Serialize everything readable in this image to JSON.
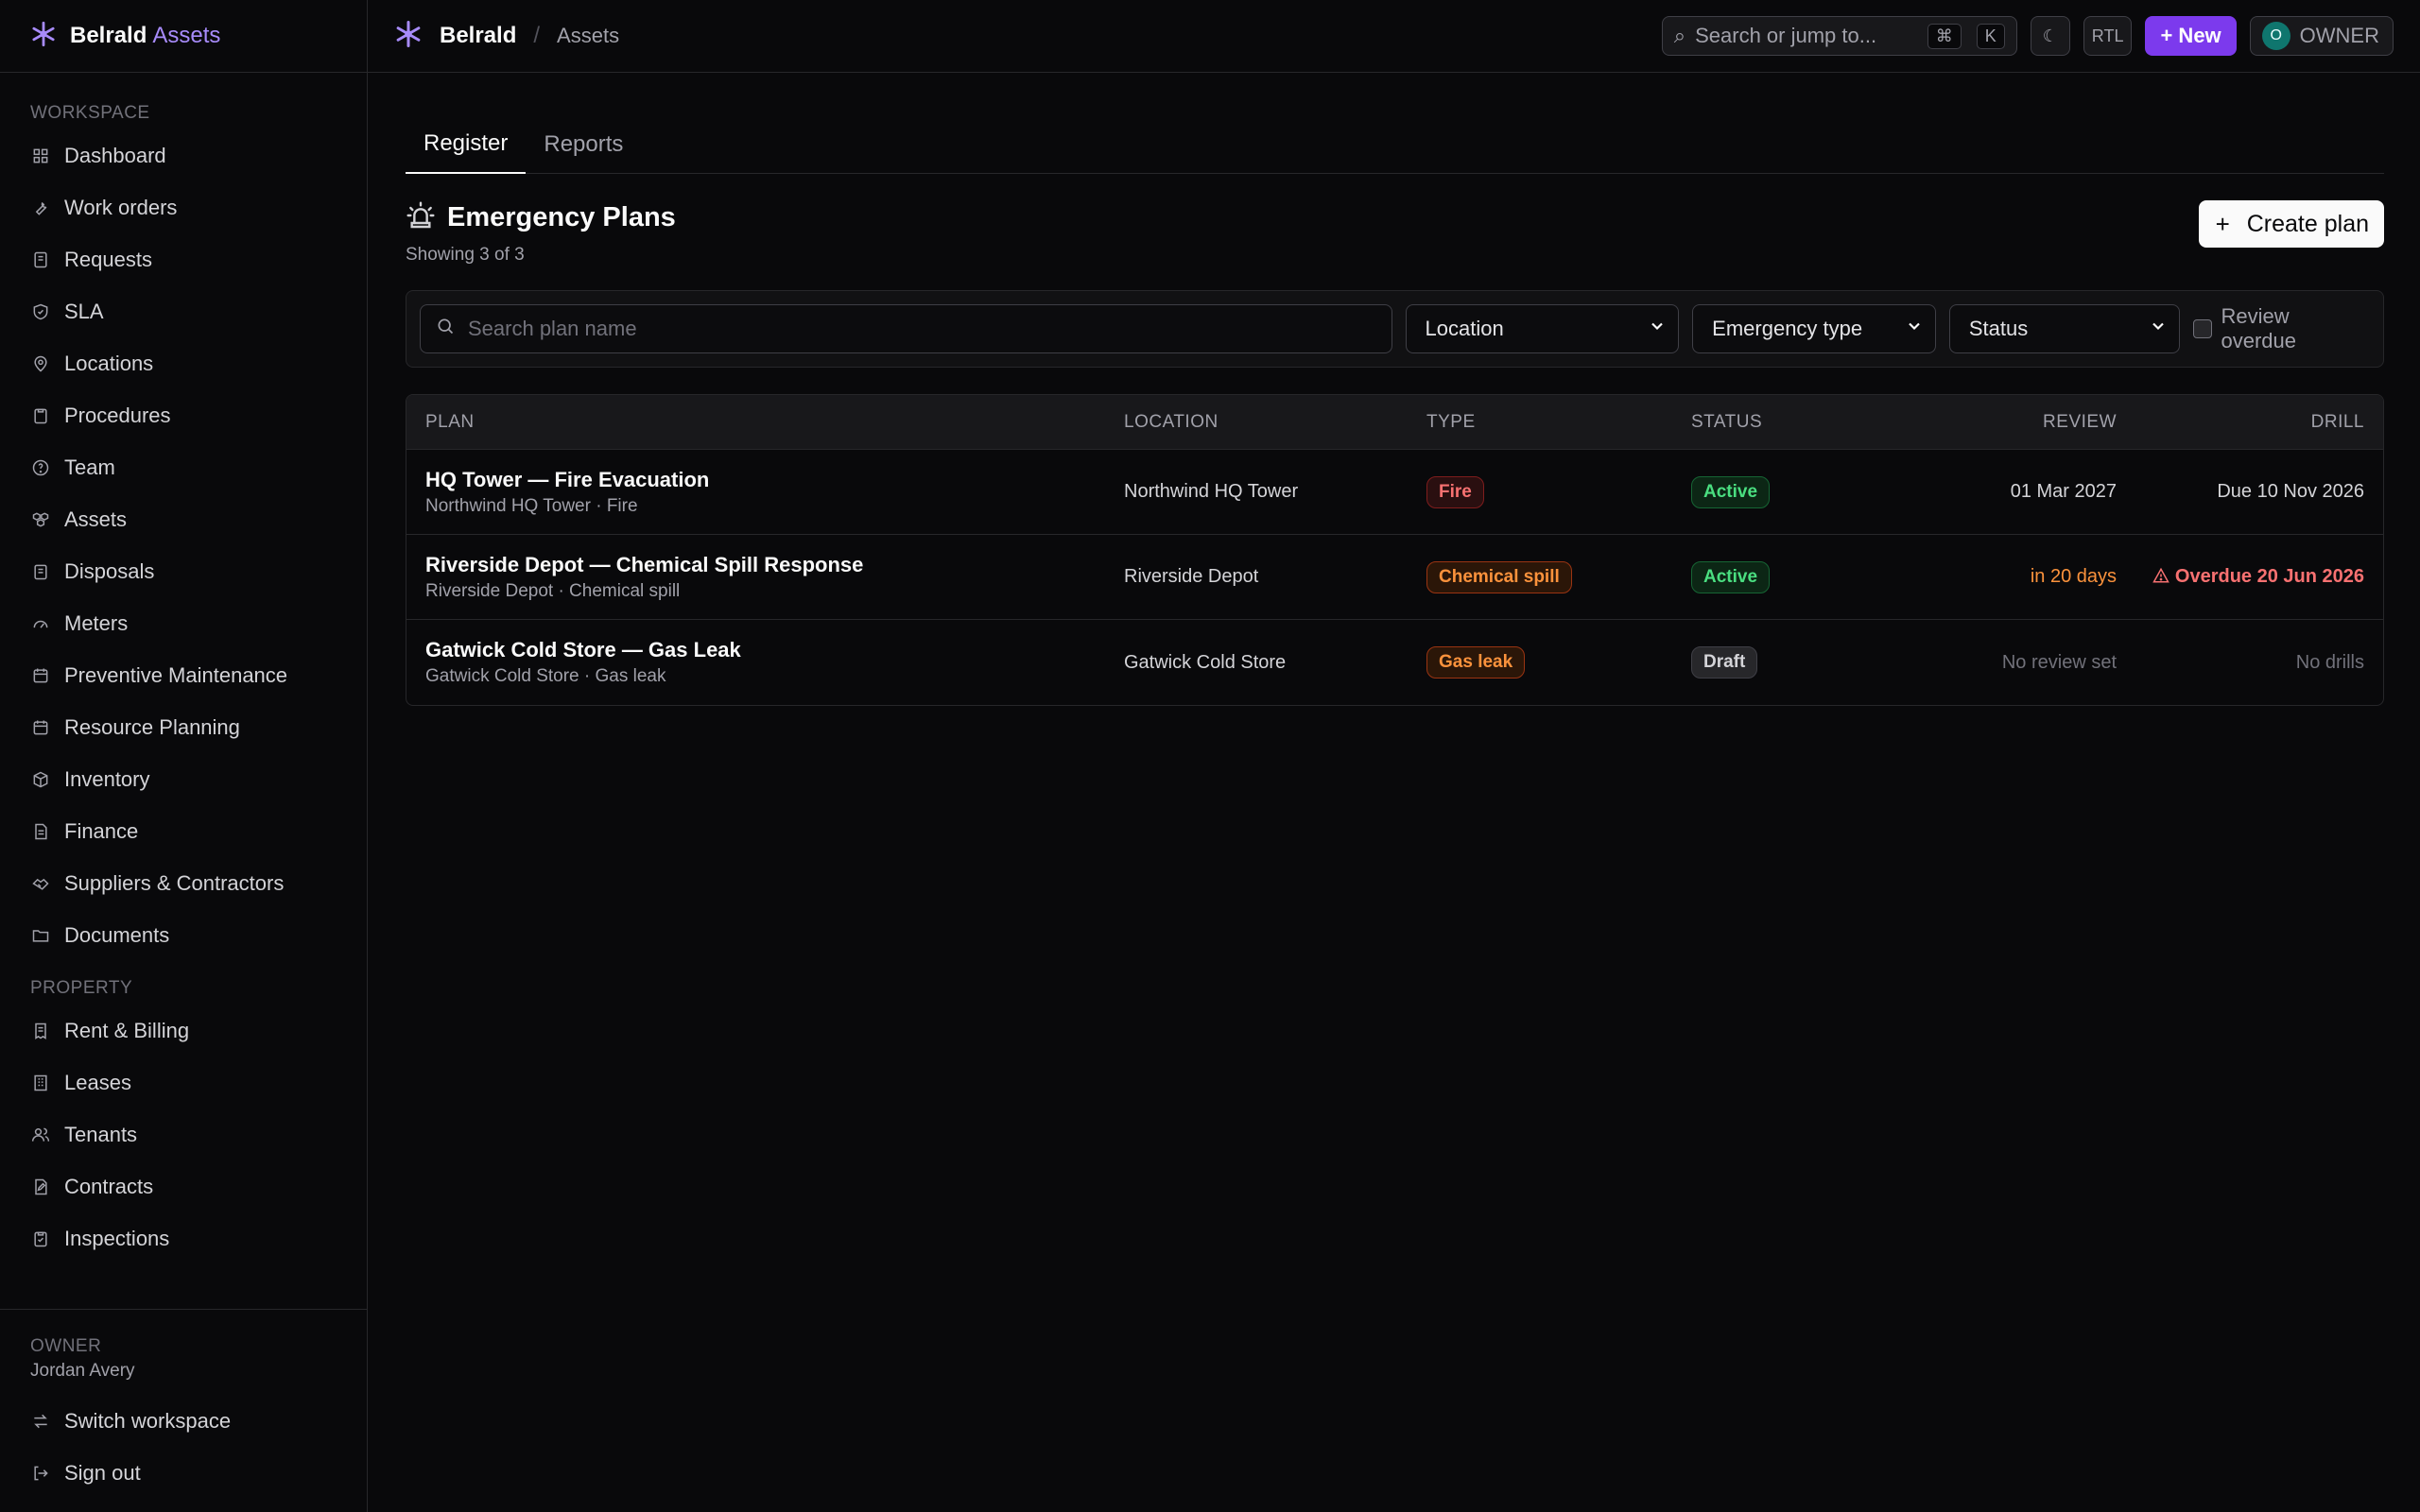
{
  "brand": {
    "name": "Belrald",
    "accent": "Assets"
  },
  "sidebar": {
    "workspace_label": "WORKSPACE",
    "workspace_items": [
      {
        "label": "Dashboard",
        "icon": "grid-icon"
      },
      {
        "label": "Work orders",
        "icon": "wrench-icon"
      },
      {
        "label": "Requests",
        "icon": "inbox-icon"
      },
      {
        "label": "SLA",
        "icon": "shield-icon"
      },
      {
        "label": "Locations",
        "icon": "pin-icon"
      },
      {
        "label": "Procedures",
        "icon": "clipboard-icon"
      },
      {
        "label": "Team",
        "icon": "help-circle-icon"
      },
      {
        "label": "Assets",
        "icon": "boxes-icon"
      },
      {
        "label": "Disposals",
        "icon": "trash-icon"
      },
      {
        "label": "Meters",
        "icon": "gauge-icon"
      },
      {
        "label": "Preventive Maintenance",
        "icon": "calendar-icon"
      },
      {
        "label": "Resource Planning",
        "icon": "calendar-icon"
      },
      {
        "label": "Inventory",
        "icon": "package-icon"
      },
      {
        "label": "Finance",
        "icon": "file-icon"
      },
      {
        "label": "Suppliers & Contractors",
        "icon": "handshake-icon"
      },
      {
        "label": "Documents",
        "icon": "folder-icon"
      }
    ],
    "property_label": "PROPERTY",
    "property_items": [
      {
        "label": "Rent & Billing",
        "icon": "receipt-icon"
      },
      {
        "label": "Leases",
        "icon": "building-icon"
      },
      {
        "label": "Tenants",
        "icon": "users-icon"
      },
      {
        "label": "Contracts",
        "icon": "file-edit-icon"
      },
      {
        "label": "Inspections",
        "icon": "clipboard-check-icon"
      }
    ],
    "footer": {
      "role": "OWNER",
      "user": "Jordan Avery",
      "switch": "Switch workspace",
      "signout": "Sign out"
    }
  },
  "topbar": {
    "crumb_root": "Belrald",
    "crumb_sep": "/",
    "crumb_page": "Assets",
    "search_placeholder": "Search or jump to...",
    "kbd1": "⌘",
    "kbd2": "K",
    "rtl": "RTL",
    "new_label": "+ New",
    "avatar_letter": "O",
    "owner_label": "OWNER"
  },
  "tabs": [
    {
      "label": "Register"
    },
    {
      "label": "Reports"
    }
  ],
  "page": {
    "title": "Emergency Plans",
    "subtitle": "Showing 3 of 3",
    "create_label": "Create plan"
  },
  "filters": {
    "search_placeholder": "Search plan name",
    "location": "Location",
    "type": "Emergency type",
    "status": "Status",
    "review_overdue": "Review overdue"
  },
  "table": {
    "headers": {
      "plan": "PLAN",
      "location": "LOCATION",
      "type": "TYPE",
      "status": "STATUS",
      "review": "REVIEW",
      "drill": "DRILL"
    },
    "rows": [
      {
        "name": "HQ Tower — Fire Evacuation",
        "sub": "Northwind HQ Tower · Fire",
        "location": "Northwind HQ Tower",
        "type": "Fire",
        "status": "Active",
        "review": "01 Mar 2027",
        "drill": "Due 10 Nov 2026"
      },
      {
        "name": "Riverside Depot — Chemical Spill Response",
        "sub": "Riverside Depot · Chemical spill",
        "location": "Riverside Depot",
        "type": "Chemical spill",
        "status": "Active",
        "review": "in 20 days",
        "drill": "Overdue 20 Jun 2026"
      },
      {
        "name": "Gatwick Cold Store — Gas Leak",
        "sub": "Gatwick Cold Store · Gas leak",
        "location": "Gatwick Cold Store",
        "type": "Gas leak",
        "status": "Draft",
        "review": "No review set",
        "drill": "No drills"
      }
    ]
  },
  "colors": {
    "accent": "#7c3aed",
    "brand_accent": "#a78bfa",
    "active": "#4ade80",
    "danger": "#f87171",
    "warning": "#fb923c"
  }
}
